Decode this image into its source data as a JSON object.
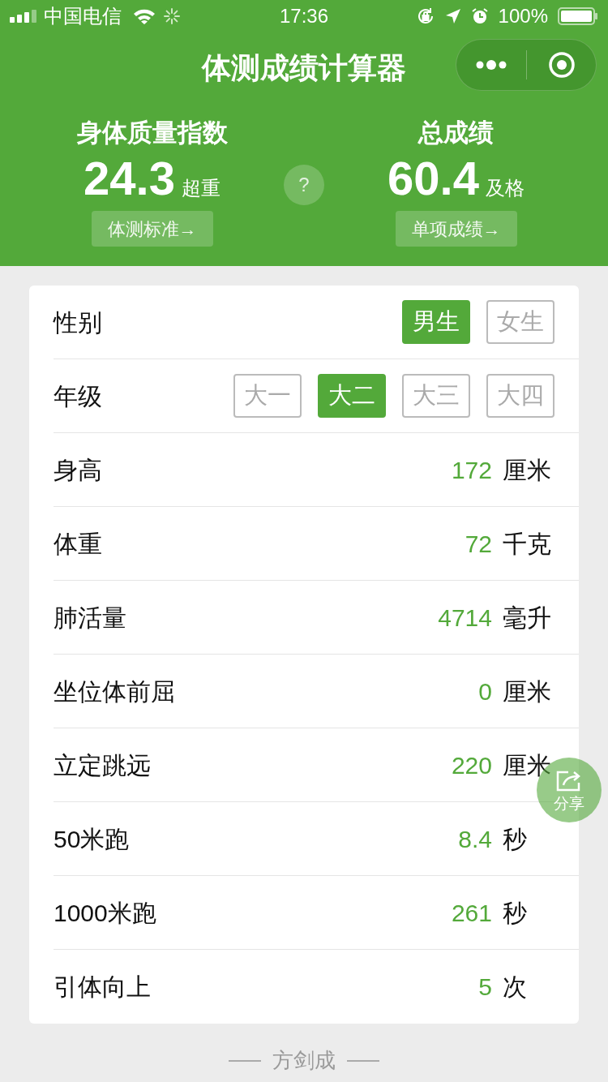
{
  "status_bar": {
    "carrier": "中国电信",
    "time": "17:36",
    "battery": "100%"
  },
  "nav": {
    "title": "体测成绩计算器"
  },
  "summary": [
    {
      "label": "身体质量指数",
      "value": "24.3",
      "grade": "超重",
      "button": "体测标准→"
    },
    {
      "label": "总成绩",
      "value": "60.4",
      "grade": "及格",
      "button": "单项成绩→"
    }
  ],
  "help": "?",
  "form": [
    {
      "kind": "options",
      "label": "性别",
      "options": [
        {
          "label": "男生",
          "selected": true
        },
        {
          "label": "女生",
          "selected": false
        }
      ]
    },
    {
      "kind": "options",
      "label": "年级",
      "options": [
        {
          "label": "大一",
          "selected": false
        },
        {
          "label": "大二",
          "selected": true
        },
        {
          "label": "大三",
          "selected": false
        },
        {
          "label": "大四",
          "selected": false
        }
      ]
    },
    {
      "kind": "input",
      "label": "身高",
      "value": "172",
      "unit": "厘米"
    },
    {
      "kind": "input",
      "label": "体重",
      "value": "72",
      "unit": "千克"
    },
    {
      "kind": "input",
      "label": "肺活量",
      "value": "4714",
      "unit": "毫升"
    },
    {
      "kind": "input",
      "label": "坐位体前屈",
      "value": "0",
      "unit": "厘米"
    },
    {
      "kind": "input",
      "label": "立定跳远",
      "value": "220",
      "unit": "厘米"
    },
    {
      "kind": "input",
      "label": "50米跑",
      "value": "8.4",
      "unit": "秒"
    },
    {
      "kind": "input",
      "label": "1000米跑",
      "value": "261",
      "unit": "秒"
    },
    {
      "kind": "input",
      "label": "引体向上",
      "value": "5",
      "unit": "次"
    }
  ],
  "share": {
    "label": "分享"
  },
  "footer": "方剑成"
}
